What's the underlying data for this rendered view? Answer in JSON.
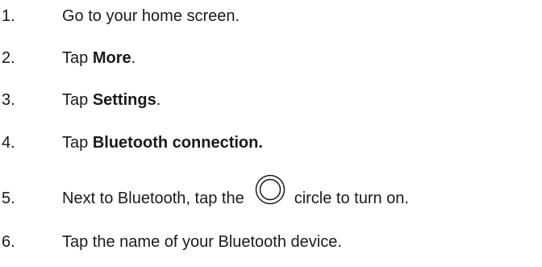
{
  "steps": [
    {
      "number": "1.",
      "text": "Go to your home screen."
    },
    {
      "number": "2.",
      "prefix": "Tap ",
      "bold": "More",
      "suffix": "."
    },
    {
      "number": "3.",
      "prefix": "Tap ",
      "bold": "Settings",
      "suffix": "."
    },
    {
      "number": "4.",
      "prefix": "Tap ",
      "bold": "Bluetooth connection."
    },
    {
      "number": "5.",
      "prefix": "Next to Bluetooth, tap the",
      "icon": "circle-icon",
      "suffix": "circle to turn on."
    },
    {
      "number": "6.",
      "text": "Tap the name of your Bluetooth device."
    }
  ]
}
